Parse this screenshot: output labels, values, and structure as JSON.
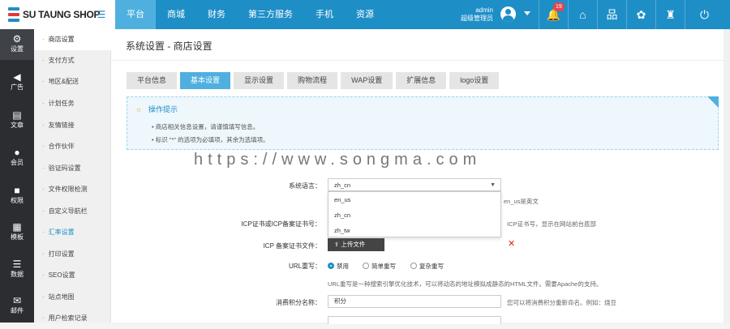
{
  "brand": {
    "name": "SU TAUNG SHOP"
  },
  "nav": [
    "平台",
    "商城",
    "财务",
    "第三方服务",
    "手机",
    "资源"
  ],
  "user": {
    "name": "admin",
    "role": "超级管理员"
  },
  "notifications": {
    "count": "19"
  },
  "sidebar": [
    {
      "label": "设置",
      "icon": "gear-icon"
    },
    {
      "label": "广告",
      "icon": "megaphone-icon"
    },
    {
      "label": "文章",
      "icon": "document-icon"
    },
    {
      "label": "会员",
      "icon": "user-icon"
    },
    {
      "label": "权限",
      "icon": "lock-icon"
    },
    {
      "label": "模板",
      "icon": "grid-icon"
    },
    {
      "label": "数据",
      "icon": "database-icon"
    },
    {
      "label": "邮件",
      "icon": "mail-icon"
    }
  ],
  "submenu": [
    "商店设置",
    "支付方式",
    "地区&配送",
    "计划任务",
    "友情链接",
    "合作伙伴",
    "验证码设置",
    "文件权限检测",
    "自定义导航栏",
    "汇率设置",
    "打印设置",
    "SEO设置",
    "站点地图",
    "用户检索记录"
  ],
  "page": {
    "title": "系统设置 - 商店设置"
  },
  "tabs": [
    "平台信息",
    "基本设置",
    "显示设置",
    "购物流程",
    "WAP设置",
    "扩展信息",
    "logo设置"
  ],
  "tip": {
    "title": "操作提示",
    "lines": [
      "商店相关信息设置，请谨慎填写信息。",
      "标识 \"*\" 的选项为必填项，其余为选填项。"
    ]
  },
  "form": {
    "lang_label": "系统语言：",
    "lang_value": "zh_cn",
    "lang_options": [
      "en_us",
      "zh_cn",
      "zh_tw"
    ],
    "lang_help": "en_us是英文",
    "icp_label": "ICP证书或ICP备案证书号：",
    "icp_help": "ICP证书号，显示在网站前台底部",
    "icp_file_label": "ICP 备案证书文件：",
    "upload_label": "上传文件",
    "url_label": "URL重写：",
    "url_options": [
      "禁用",
      "简单重写",
      "复杂重写"
    ],
    "url_help": "URL重写是一种搜索引擎优化技术，可以将动态的地址模拟成静态的HTML文件。需要Apache的支持。",
    "points_label": "消费积分名称：",
    "points_value": "积分",
    "points_help": "您可以将消费积分重新命名。例如：烧豆"
  },
  "watermark": "https://www.songma.com"
}
